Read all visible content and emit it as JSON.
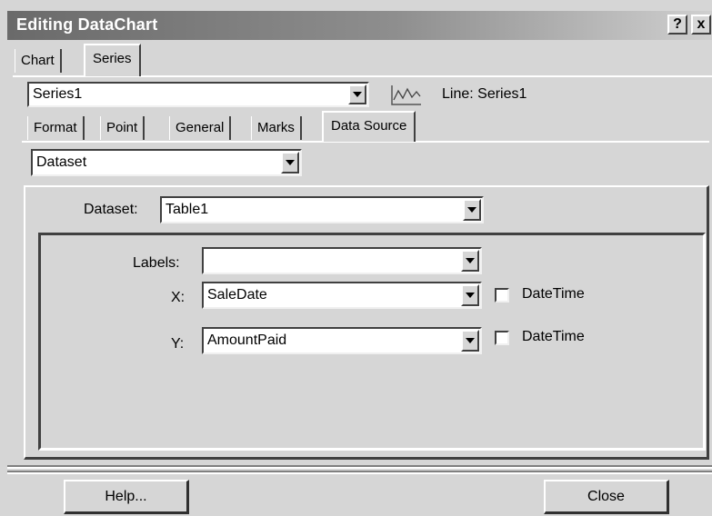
{
  "window": {
    "title": "Editing DataChart",
    "help_glyph": "?",
    "close_glyph": "x"
  },
  "top_tabs": [
    {
      "label": "Chart",
      "active": false
    },
    {
      "label": "Series",
      "active": true
    }
  ],
  "series_select": {
    "value": "Series1",
    "series_label": "Line: Series1",
    "series_icon": "line-series-icon"
  },
  "sub_tabs": [
    {
      "label": "Format",
      "active": false
    },
    {
      "label": "Point",
      "active": false
    },
    {
      "label": "General",
      "active": false
    },
    {
      "label": "Marks",
      "active": false
    },
    {
      "label": "Data Source",
      "active": true
    }
  ],
  "source_select": {
    "value": "Dataset"
  },
  "dataset": {
    "label": "Dataset:",
    "value": "Table1"
  },
  "mapping": {
    "labels": {
      "label": "Labels:",
      "value": ""
    },
    "x": {
      "label": "X:",
      "value": "SaleDate",
      "datetime_label": "DateTime",
      "datetime_checked": false
    },
    "y": {
      "label": "Y:",
      "value": "AmountPaid",
      "datetime_label": "DateTime",
      "datetime_checked": false
    }
  },
  "footer": {
    "help_button": "Help...",
    "close_button": "Close"
  }
}
